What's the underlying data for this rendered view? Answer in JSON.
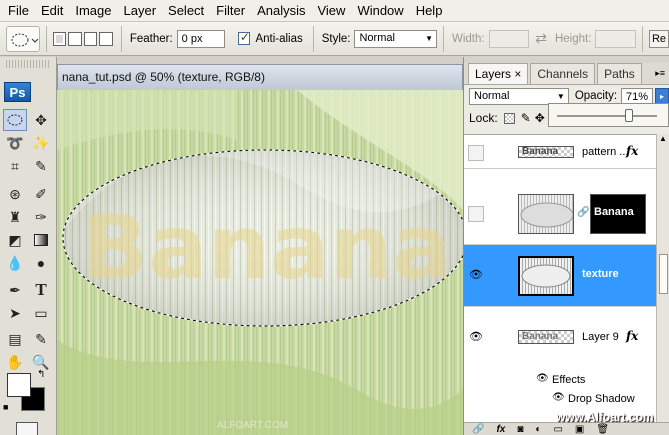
{
  "menubar": {
    "items": [
      "File",
      "Edit",
      "Image",
      "Layer",
      "Select",
      "Filter",
      "Analysis",
      "View",
      "Window",
      "Help"
    ]
  },
  "options": {
    "feather_label": "Feather:",
    "feather_value": "0 px",
    "antialias_label": "Anti-alias",
    "style_label": "Style:",
    "style_value": "Normal",
    "width_label": "Width:",
    "height_label": "Height:",
    "refine_label": "Re"
  },
  "toolbox": {
    "logo": "Ps"
  },
  "document": {
    "title": "nana_tut.psd @ 50% (texture, RGB/8)",
    "canvas_text": "Banana"
  },
  "layers_panel": {
    "tabs": [
      "Layers",
      "Channels",
      "Paths"
    ],
    "tab_close": "×",
    "blend_mode": "Normal",
    "opacity_label": "Opacity:",
    "opacity_value": "71%",
    "lock_label": "Lock:",
    "layers": [
      {
        "name": "pattern ...",
        "fx": "fx",
        "visible": false
      },
      {
        "name": "Banana",
        "mask_text": "Banana",
        "visible": false
      },
      {
        "name": "texture",
        "visible": true,
        "selected": true
      },
      {
        "name": "Layer 9",
        "fx": "fx",
        "visible": true
      }
    ],
    "effects_label": "Effects",
    "effect_item": "Drop Shadow"
  },
  "watermark": "www.Alfoart.com",
  "colors": {
    "selection": "#3399ff",
    "canvas_green": "#c6d89e"
  }
}
